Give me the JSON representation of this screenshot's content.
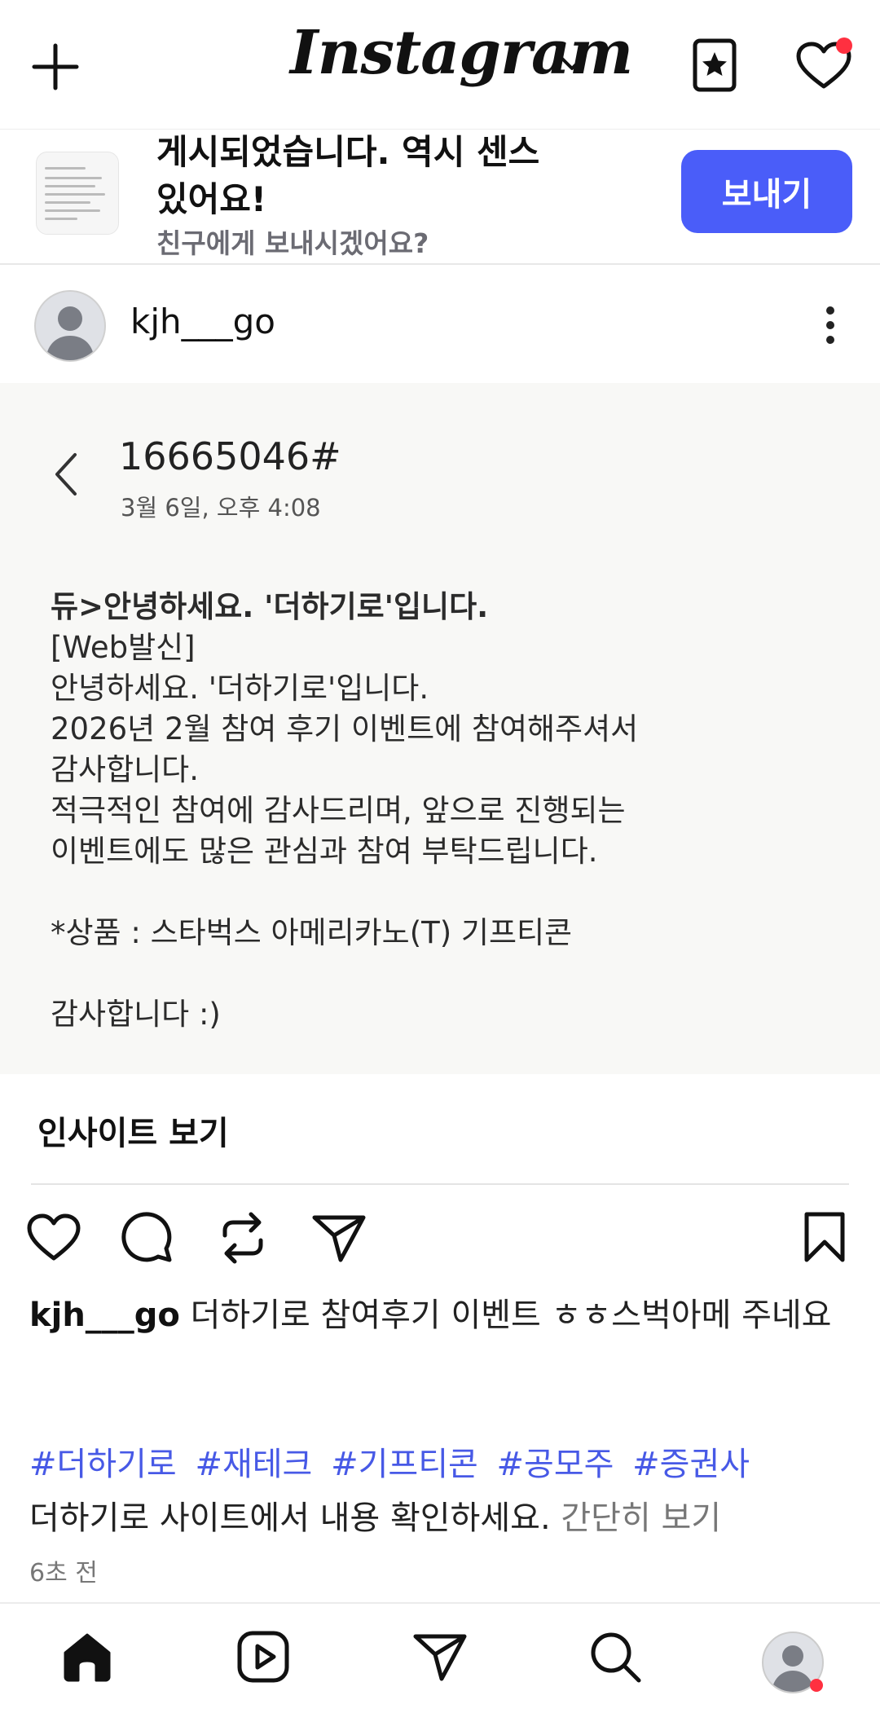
{
  "header": {
    "logo": "Instagram",
    "icons": [
      "plus-icon",
      "chevron-down-icon",
      "star-bookmark-icon",
      "heart-icon"
    ],
    "has_notification": true
  },
  "share_banner": {
    "title": "게시되었습니다. 역시 센스 있어요!",
    "subtitle": "친구에게 보내시겠어요?",
    "send_label": "보내기",
    "send_color": "#4a5df9"
  },
  "post": {
    "username": "kjh___go",
    "image": {
      "sender": "16665046#",
      "datetime": "3월 6일, 오후 4:08",
      "lines": [
        {
          "text": "듀>안녕하세요. '더하기로'입니다.",
          "bold": true
        },
        {
          "text": "[Web발신]",
          "bold": false
        },
        {
          "text": "안녕하세요. '더하기로'입니다.",
          "bold": false
        },
        {
          "text": "2026년 2월 참여 후기 이벤트에 참여해주셔서",
          "bold": false
        },
        {
          "text": "감사합니다.",
          "bold": false
        },
        {
          "text": "적극적인 참여에 감사드리며, 앞으로 진행되는",
          "bold": false
        },
        {
          "text": "이벤트에도 많은 관심과 참여 부탁드립니다.",
          "bold": false
        },
        {
          "text": "",
          "bold": false
        },
        {
          "text": "*상품 : 스타벅스 아메리카노(T) 기프티콘",
          "bold": false
        },
        {
          "text": "",
          "bold": false
        },
        {
          "text": "감사합니다 :)",
          "bold": false
        }
      ]
    },
    "insights_label": "인사이트 보기",
    "caption_user": "kjh___go",
    "caption_text": " 더하기로 참여후기 이벤트 ㅎㅎ스벅아메 주네요",
    "hashtags": [
      "#더하기로",
      "#재테크",
      "#기프티콘",
      "#공모주",
      "#증권사"
    ],
    "caption_line2": "더하기로 사이트에서 내용 확인하세요. ",
    "more_label": "간단히 보기",
    "time": "6초 전",
    "hashtag_color": "#4759e6"
  },
  "bottom_nav": {
    "items": [
      "home-icon",
      "reels-icon",
      "direct-icon",
      "search-icon",
      "profile-avatar"
    ],
    "active": "home-icon"
  }
}
